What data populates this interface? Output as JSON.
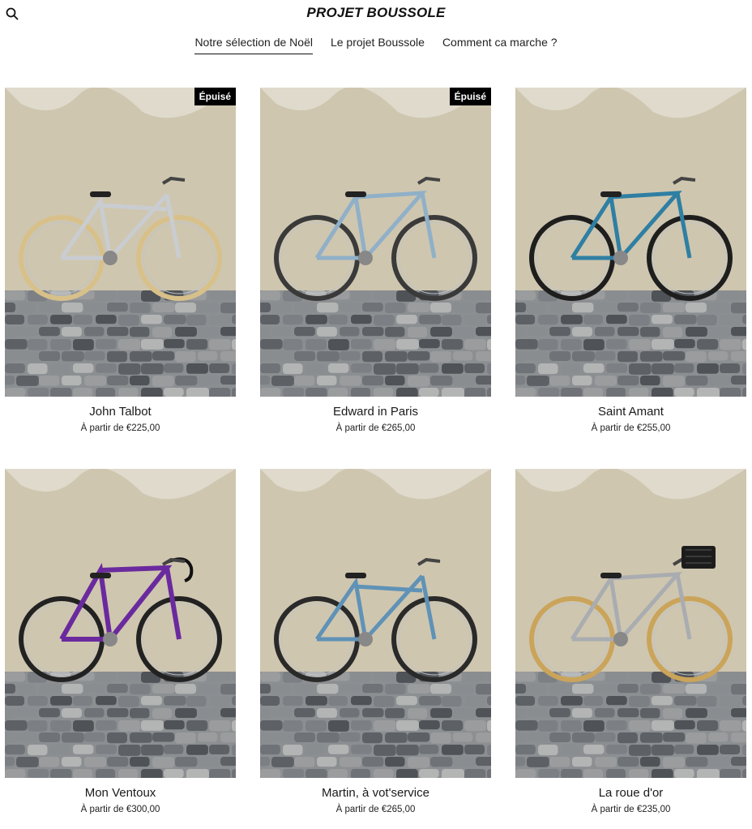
{
  "header": {
    "brand": "PROJET BOUSSOLE",
    "search_icon": "search-icon",
    "nav": [
      {
        "label": "Notre sélection de Noël",
        "active": true
      },
      {
        "label": "Le projet Boussole",
        "active": false
      },
      {
        "label": "Comment ca marche ?",
        "active": false
      }
    ]
  },
  "products": [
    {
      "name": "John Talbot",
      "price": "À partir de €225,00",
      "badge": "Épuisé",
      "frame_color": "#c9cdd2",
      "tire_color": "#d8c08a",
      "style": "step"
    },
    {
      "name": "Edward in Paris",
      "price": "À partir de €265,00",
      "badge": "Épuisé",
      "frame_color": "#8fb0c8",
      "tire_color": "#3a3a3a",
      "style": "diamond"
    },
    {
      "name": "Saint Amant",
      "price": "À partir de €255,00",
      "badge": "",
      "frame_color": "#2f7fa3",
      "tire_color": "#1e1e1e",
      "style": "diamond"
    },
    {
      "name": "Mon Ventoux",
      "price": "À partir de €300,00",
      "badge": "",
      "frame_color": "#6a2a9e",
      "tire_color": "#222222",
      "style": "road"
    },
    {
      "name": "Martin, à vot'service",
      "price": "À partir de €265,00",
      "badge": "",
      "frame_color": "#5f92b6",
      "tire_color": "#2a2a2a",
      "style": "step"
    },
    {
      "name": "La roue d'or",
      "price": "À partir de €235,00",
      "badge": "",
      "frame_color": "#a9acb0",
      "tire_color": "#caa45a",
      "style": "basket"
    }
  ]
}
